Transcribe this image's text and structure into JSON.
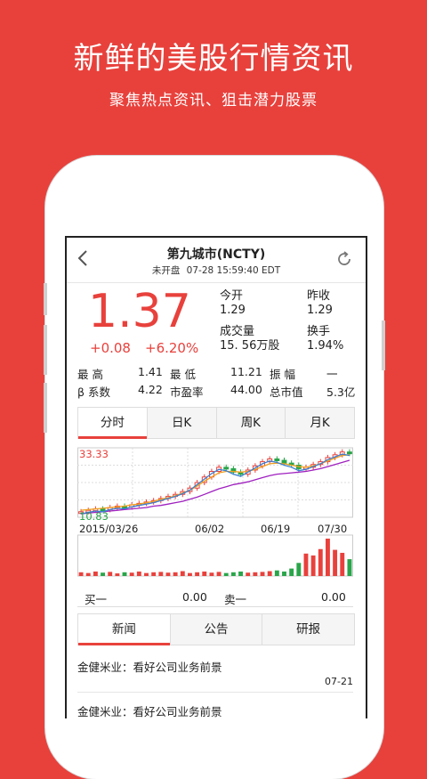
{
  "promo": {
    "headline": "新鲜的美股行情资讯",
    "subline": "聚焦热点资讯、狙击潜力股票"
  },
  "colors": {
    "accent": "#e8413c",
    "up": "#e8413c",
    "down": "#2aa54a"
  },
  "nav": {
    "title": "第九城市(NCTY)",
    "status": "未开盘",
    "datetime": "07-28  15:59:40  EDT",
    "back_icon": "chevron-left-icon",
    "refresh_icon": "refresh-icon"
  },
  "quote": {
    "price": "1.37",
    "change": "+0.08",
    "change_pct": "+6.20%",
    "open_label": "今开",
    "open": "1.29",
    "prev_close_label": "昨收",
    "prev_close": "1.29",
    "volume_label": "成交量",
    "volume": "15. 56万股",
    "turnover_label": "换手",
    "turnover": "1.94%"
  },
  "stats": {
    "high_label": "最    高",
    "high": "1.41",
    "low_label": "最    低",
    "low": "11.21",
    "amplitude_label": "振    幅",
    "amplitude": "一",
    "beta_label": "β 系数",
    "beta": "4.22",
    "pe_label": "市盈率",
    "pe": "44.00",
    "mcap_label": "总市值",
    "mcap": "5.3亿"
  },
  "chart_tabs": [
    "分时",
    "日K",
    "周K",
    "月K"
  ],
  "chart_data": {
    "type": "line",
    "y_max_label": "33.33",
    "y_min_label": "10.83",
    "x_labels": [
      "2015/03/26",
      "06/02",
      "06/19",
      "07/30"
    ],
    "price": [
      0.08,
      0.1,
      0.12,
      0.11,
      0.14,
      0.16,
      0.15,
      0.18,
      0.2,
      0.22,
      0.24,
      0.27,
      0.3,
      0.33,
      0.37,
      0.42,
      0.5,
      0.58,
      0.66,
      0.72,
      0.7,
      0.65,
      0.62,
      0.68,
      0.74,
      0.8,
      0.84,
      0.82,
      0.78,
      0.75,
      0.7,
      0.72,
      0.76,
      0.8,
      0.86,
      0.9,
      0.94,
      0.92
    ],
    "ma1": [
      0.1,
      0.11,
      0.12,
      0.13,
      0.14,
      0.15,
      0.16,
      0.18,
      0.19,
      0.21,
      0.23,
      0.26,
      0.28,
      0.31,
      0.35,
      0.39,
      0.45,
      0.52,
      0.58,
      0.64,
      0.66,
      0.66,
      0.65,
      0.66,
      0.69,
      0.73,
      0.77,
      0.78,
      0.77,
      0.75,
      0.73,
      0.72,
      0.74,
      0.77,
      0.81,
      0.85,
      0.89,
      0.9
    ],
    "ma2": [
      0.05,
      0.06,
      0.07,
      0.08,
      0.09,
      0.1,
      0.11,
      0.12,
      0.13,
      0.14,
      0.16,
      0.17,
      0.19,
      0.21,
      0.23,
      0.26,
      0.29,
      0.33,
      0.37,
      0.41,
      0.44,
      0.47,
      0.49,
      0.51,
      0.54,
      0.57,
      0.6,
      0.62,
      0.63,
      0.64,
      0.65,
      0.66,
      0.68,
      0.7,
      0.73,
      0.76,
      0.79,
      0.82
    ],
    "volume": [
      0.1,
      0.08,
      0.12,
      0.09,
      0.11,
      0.07,
      0.1,
      0.09,
      0.12,
      0.08,
      0.1,
      0.11,
      0.09,
      0.1,
      0.13,
      0.08,
      0.1,
      0.12,
      0.09,
      0.11,
      0.08,
      0.1,
      0.12,
      0.09,
      0.1,
      0.11,
      0.13,
      0.15,
      0.12,
      0.2,
      0.35,
      0.6,
      0.55,
      0.72,
      1.0,
      0.7,
      0.62,
      0.45
    ]
  },
  "orderbook": {
    "bid_label": "买一",
    "bid": "0.00",
    "ask_label": "卖一",
    "ask": "0.00"
  },
  "news_tabs": [
    "新闻",
    "公告",
    "研报"
  ],
  "news": [
    {
      "title": "金健米业：看好公司业务前景",
      "date": "07-21"
    },
    {
      "title": "金健米业：看好公司业务前景",
      "date": ""
    }
  ]
}
